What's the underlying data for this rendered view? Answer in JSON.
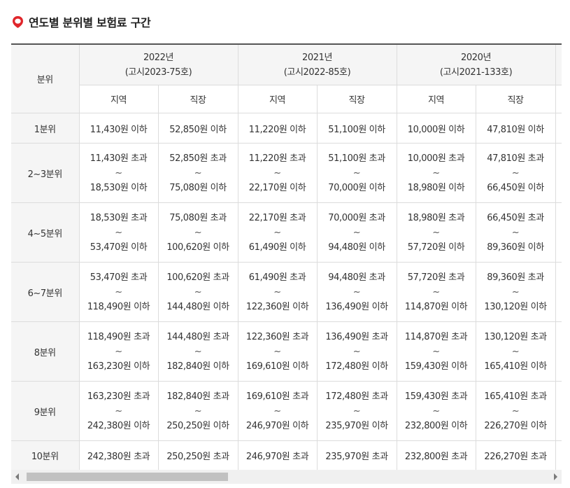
{
  "title": "연도별 분위별 보험료 구간",
  "colors": {
    "accent": "#e0262b",
    "header_bg": "#f5f5f5",
    "border": "#dcdcdc"
  },
  "icons": {
    "title": "location-pin-icon"
  },
  "header": {
    "quantile_label": "분위",
    "years": [
      {
        "year": "2022년",
        "notice": "(고시2023-75호)",
        "sub": [
          "지역",
          "직장"
        ]
      },
      {
        "year": "2021년",
        "notice": "(고시2022-85호)",
        "sub": [
          "지역",
          "직장"
        ]
      },
      {
        "year": "2020년",
        "notice": "(고시2021-133호)",
        "sub": [
          "지역",
          "직장"
        ]
      }
    ]
  },
  "rows": [
    {
      "label": "1분위",
      "cells": [
        {
          "text": "11,430원 이하"
        },
        {
          "text": "52,850원 이하"
        },
        {
          "text": "11,220원 이하"
        },
        {
          "text": "51,100원 이하"
        },
        {
          "text": "10,000원 이하"
        },
        {
          "text": "47,810원 이하"
        }
      ]
    },
    {
      "label": "2~3분위",
      "cells": [
        {
          "from": "11,430원 초과",
          "to": "18,530원 이하"
        },
        {
          "from": "52,850원 초과",
          "to": "75,080원 이하"
        },
        {
          "from": "11,220원 초과",
          "to": "22,170원 이하"
        },
        {
          "from": "51,100원 초과",
          "to": "70,000원 이하"
        },
        {
          "from": "10,000원 초과",
          "to": "18,980원 이하"
        },
        {
          "from": "47,810원 초과",
          "to": "66,450원 이하"
        }
      ]
    },
    {
      "label": "4~5분위",
      "cells": [
        {
          "from": "18,530원 초과",
          "to": "53,470원 이하"
        },
        {
          "from": "75,080원 초과",
          "to": "100,620원 이하"
        },
        {
          "from": "22,170원 초과",
          "to": "61,490원 이하"
        },
        {
          "from": "70,000원 초과",
          "to": "94,480원 이하"
        },
        {
          "from": "18,980원 초과",
          "to": "57,720원 이하"
        },
        {
          "from": "66,450원 초과",
          "to": "89,360원 이하"
        }
      ]
    },
    {
      "label": "6~7분위",
      "cells": [
        {
          "from": "53,470원 초과",
          "to": "118,490원 이하"
        },
        {
          "from": "100,620원 초과",
          "to": "144,480원 이하"
        },
        {
          "from": "61,490원 초과",
          "to": "122,360원 이하"
        },
        {
          "from": "94,480원 초과",
          "to": "136,490원 이하"
        },
        {
          "from": "57,720원 초과",
          "to": "114,870원 이하"
        },
        {
          "from": "89,360원 초과",
          "to": "130,120원 이하"
        }
      ]
    },
    {
      "label": "8분위",
      "cells": [
        {
          "from": "118,490원 초과",
          "to": "163,230원 이하"
        },
        {
          "from": "144,480원 초과",
          "to": "182,840원 이하"
        },
        {
          "from": "122,360원 초과",
          "to": "169,610원 이하"
        },
        {
          "from": "136,490원 초과",
          "to": "172,480원 이하"
        },
        {
          "from": "114,870원 초과",
          "to": "159,430원 이하"
        },
        {
          "from": "130,120원 초과",
          "to": "165,410원 이하"
        }
      ]
    },
    {
      "label": "9분위",
      "cells": [
        {
          "from": "163,230원 초과",
          "to": "242,380원 이하"
        },
        {
          "from": "182,840원 초과",
          "to": "250,250원 이하"
        },
        {
          "from": "169,610원 초과",
          "to": "246,970원 이하"
        },
        {
          "from": "172,480원 초과",
          "to": "235,970원 이하"
        },
        {
          "from": "159,430원 초과",
          "to": "232,800원 이하"
        },
        {
          "from": "165,410원 초과",
          "to": "226,270원 이하"
        }
      ]
    },
    {
      "label": "10분위",
      "cells": [
        {
          "text": "242,380원 초과"
        },
        {
          "text": "250,250원 초과"
        },
        {
          "text": "246,970원 초과"
        },
        {
          "text": "235,970원 초과"
        },
        {
          "text": "232,800원 초과"
        },
        {
          "text": "226,270원 초과"
        }
      ]
    }
  ],
  "tilde": "~"
}
